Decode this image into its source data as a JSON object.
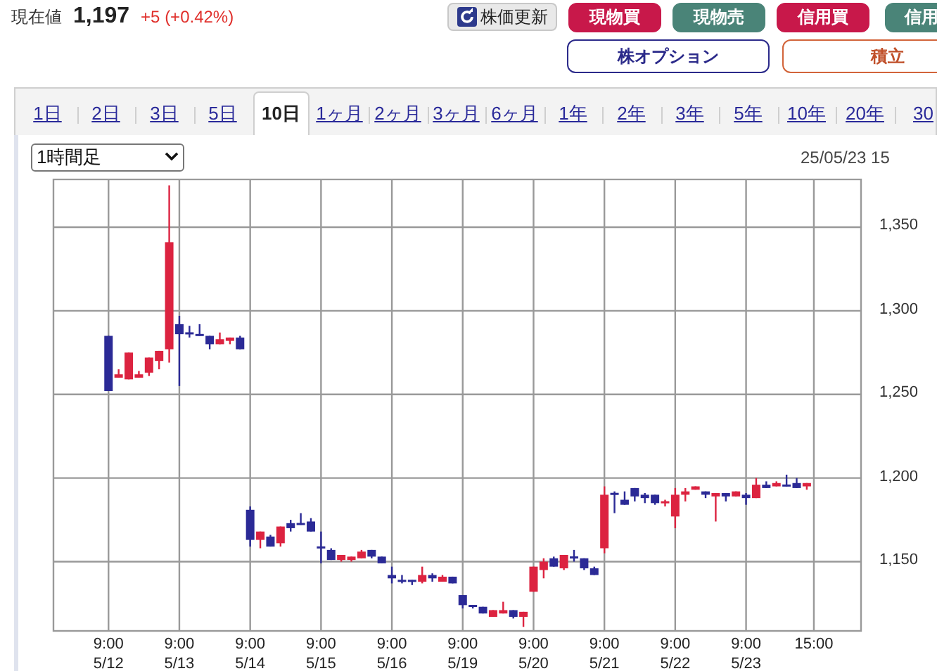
{
  "price_header": {
    "label": "現在値",
    "value": "1,197",
    "change": "+5 (+0.42%)"
  },
  "toolbar_buttons": [
    {
      "label": "株価更新",
      "kind": "refresh"
    },
    {
      "label": "現物買",
      "kind": "buy"
    },
    {
      "label": "現物売",
      "kind": "sell"
    },
    {
      "label": "信用買",
      "kind": "buy"
    },
    {
      "label": "信用",
      "kind": "sell"
    }
  ],
  "secondary_buttons": [
    {
      "label": "株オプション",
      "kind": "option"
    },
    {
      "label": "積立",
      "kind": "accumulate"
    }
  ],
  "period_tabs": [
    {
      "label": "1日",
      "selected": false
    },
    {
      "label": "2日",
      "selected": false
    },
    {
      "label": "3日",
      "selected": false
    },
    {
      "label": "5日",
      "selected": false
    },
    {
      "label": "10日",
      "selected": true
    },
    {
      "label": "1ヶ月",
      "selected": false
    },
    {
      "label": "2ヶ月",
      "selected": false
    },
    {
      "label": "3ヶ月",
      "selected": false
    },
    {
      "label": "6ヶ月",
      "selected": false
    },
    {
      "label": "1年",
      "selected": false
    },
    {
      "label": "2年",
      "selected": false
    },
    {
      "label": "3年",
      "selected": false
    },
    {
      "label": "5年",
      "selected": false
    },
    {
      "label": "10年",
      "selected": false
    },
    {
      "label": "20年",
      "selected": false
    },
    {
      "label": "30",
      "selected": false
    }
  ],
  "interval_select": {
    "value": "1時間足"
  },
  "timestamp": "25/05/23 15",
  "chart": {
    "chart_data": {
      "type": "candlestick",
      "categories": [
        "9:00\n5/12",
        null,
        null,
        null,
        null,
        null,
        null,
        "9:00\n5/13",
        null,
        null,
        null,
        null,
        null,
        null,
        "9:00\n5/14",
        null,
        null,
        null,
        null,
        null,
        null,
        "9:00\n5/15",
        null,
        null,
        null,
        null,
        null,
        null,
        "9:00\n5/16",
        null,
        null,
        null,
        null,
        null,
        null,
        "9:00\n5/19",
        null,
        null,
        null,
        null,
        null,
        null,
        "9:00\n5/20",
        null,
        null,
        null,
        null,
        null,
        null,
        "9:00\n5/21",
        null,
        null,
        null,
        null,
        null,
        null,
        "9:00\n5/22",
        null,
        null,
        null,
        null,
        null,
        null,
        "9:00\n5/23",
        null,
        null,
        null,
        null,
        null,
        "15:00"
      ],
      "ohlc": [
        [
          1285,
          1285,
          1252,
          1252
        ],
        [
          1260,
          1265,
          1260,
          1262
        ],
        [
          1259,
          1275,
          1259,
          1275
        ],
        [
          1260,
          1264,
          1260,
          1262
        ],
        [
          1263,
          1272,
          1261,
          1272
        ],
        [
          1270,
          1276,
          1265,
          1276
        ],
        [
          1277,
          1375,
          1269,
          1341
        ],
        [
          1292,
          1297,
          1255,
          1286
        ],
        [
          1287,
          1291,
          1284,
          1286
        ],
        [
          1286,
          1292,
          1285,
          1285
        ],
        [
          1285,
          1285,
          1277,
          1280
        ],
        [
          1280,
          1287,
          1280,
          1283
        ],
        [
          1282,
          1284,
          1280,
          1284
        ],
        [
          1284,
          1285,
          1277,
          1277
        ],
        [
          1181,
          1183,
          1159,
          1163
        ],
        [
          1163,
          1168,
          1158,
          1168
        ],
        [
          1165,
          1166,
          1159,
          1159
        ],
        [
          1161,
          1171,
          1159,
          1171
        ],
        [
          1173,
          1175,
          1168,
          1170
        ],
        [
          1173,
          1179,
          1172,
          1172
        ],
        [
          1174,
          1176,
          1168,
          1168
        ],
        [
          1159,
          1168,
          1149,
          1158
        ],
        [
          1157,
          1158,
          1151,
          1151
        ],
        [
          1151,
          1154,
          1150,
          1154
        ],
        [
          1151,
          1153,
          1150,
          1153
        ],
        [
          1152,
          1157,
          1152,
          1156
        ],
        [
          1157,
          1157,
          1152,
          1153
        ],
        [
          1153,
          1153,
          1149,
          1149
        ],
        [
          1142,
          1147,
          1137,
          1140
        ],
        [
          1139,
          1142,
          1137,
          1138
        ],
        [
          1139,
          1139,
          1136,
          1138
        ],
        [
          1138,
          1147,
          1137,
          1142
        ],
        [
          1142,
          1143,
          1138,
          1140
        ],
        [
          1138,
          1142,
          1138,
          1141
        ],
        [
          1141,
          1141,
          1137,
          1137
        ],
        [
          1130,
          1130,
          1122,
          1124
        ],
        [
          1124,
          1124,
          1122,
          1123
        ],
        [
          1123,
          1123,
          1119,
          1119
        ],
        [
          1117,
          1121,
          1117,
          1121
        ],
        [
          1119,
          1126,
          1119,
          1121
        ],
        [
          1121,
          1121,
          1116,
          1117
        ],
        [
          1117,
          1120,
          1111,
          1120
        ],
        [
          1132,
          1147,
          1132,
          1147
        ],
        [
          1145,
          1152,
          1140,
          1150
        ],
        [
          1152,
          1153,
          1147,
          1147
        ],
        [
          1146,
          1154,
          1145,
          1154
        ],
        [
          1153,
          1157,
          1150,
          1152
        ],
        [
          1152,
          1152,
          1145,
          1146
        ],
        [
          1146,
          1147,
          1142,
          1142
        ],
        [
          1158,
          1195,
          1155,
          1190
        ],
        [
          1191,
          1192,
          1179,
          1190
        ],
        [
          1187,
          1192,
          1184,
          1184
        ],
        [
          1194,
          1194,
          1186,
          1189
        ],
        [
          1190,
          1191,
          1185,
          1188
        ],
        [
          1190,
          1190,
          1184,
          1185
        ],
        [
          1185,
          1187,
          1183,
          1186
        ],
        [
          1177,
          1194,
          1170,
          1190
        ],
        [
          1190,
          1194,
          1186,
          1192
        ],
        [
          1193,
          1195,
          1193,
          1195
        ],
        [
          1192,
          1192,
          1188,
          1190
        ],
        [
          1189,
          1191,
          1174,
          1191
        ],
        [
          1191,
          1191,
          1186,
          1189
        ],
        [
          1189,
          1192,
          1189,
          1192
        ],
        [
          1190,
          1191,
          1184,
          1188
        ],
        [
          1188,
          1200,
          1188,
          1196
        ],
        [
          1196,
          1198,
          1194,
          1194
        ],
        [
          1195,
          1198,
          1195,
          1197
        ],
        [
          1196,
          1202,
          1195,
          1195
        ],
        [
          1197,
          1200,
          1194,
          1194
        ],
        [
          1195,
          1197,
          1193,
          1197
        ]
      ],
      "ylim": [
        1109,
        1379
      ],
      "grid": true,
      "yticks": [
        {
          "value": 1150,
          "label": "1,150"
        },
        {
          "value": 1200,
          "label": "1,200"
        },
        {
          "value": 1250,
          "label": "1,250"
        },
        {
          "value": 1300,
          "label": "1,300"
        },
        {
          "value": 1350,
          "label": "1,350"
        }
      ]
    }
  }
}
